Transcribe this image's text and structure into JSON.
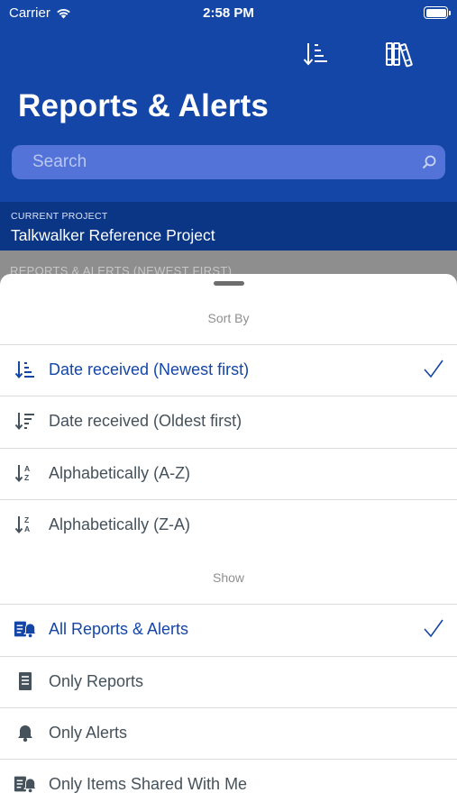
{
  "status_bar": {
    "carrier": "Carrier",
    "time": "2:58 PM"
  },
  "header": {
    "title": "Reports & Alerts"
  },
  "search": {
    "placeholder": "Search"
  },
  "project": {
    "label": "CURRENT PROJECT",
    "name": "Talkwalker Reference Project"
  },
  "list_header_behind": "REPORTS & ALERTS (NEWEST FIRST)",
  "sheet": {
    "sort_title": "Sort By",
    "sort_options": [
      {
        "label": "Date received (Newest first)",
        "icon": "sort-newest-icon",
        "selected": true
      },
      {
        "label": "Date received (Oldest first)",
        "icon": "sort-oldest-icon",
        "selected": false
      },
      {
        "label": "Alphabetically (A-Z)",
        "icon": "sort-az-icon",
        "selected": false
      },
      {
        "label": "Alphabetically (Z-A)",
        "icon": "sort-za-icon",
        "selected": false
      }
    ],
    "show_title": "Show",
    "show_options": [
      {
        "label": "All Reports & Alerts",
        "icon": "reports-alerts-icon",
        "selected": true
      },
      {
        "label": "Only Reports",
        "icon": "report-document-icon",
        "selected": false
      },
      {
        "label": "Only Alerts",
        "icon": "bell-icon",
        "selected": false
      },
      {
        "label": "Only Items Shared With Me",
        "icon": "shared-reports-alerts-icon",
        "selected": false
      }
    ]
  },
  "colors": {
    "brand_blue": "#1446a8",
    "dark_blue": "#0b3585",
    "text_gray": "#45515b"
  }
}
